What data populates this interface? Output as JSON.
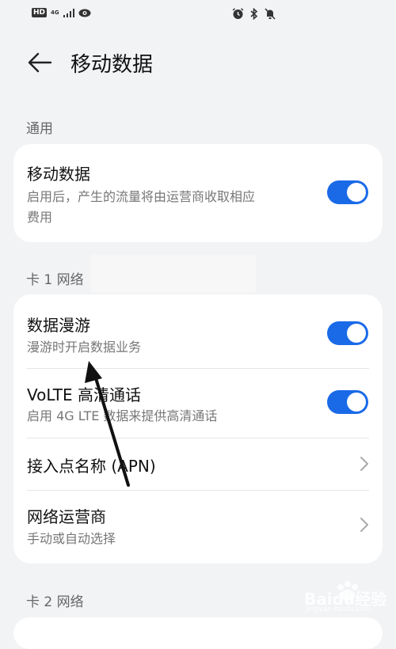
{
  "status_bar": {
    "hd": "HD",
    "network": "4G"
  },
  "header": {
    "title": "移动数据"
  },
  "sections": {
    "general_label": "通用",
    "card1_label": "卡 1 网络",
    "card2_label": "卡 2 网络"
  },
  "mobile_data": {
    "title": "移动数据",
    "subtitle_line1": "启用后，产生的流量将由运营商收取相应",
    "subtitle_line2": "费用",
    "enabled": true
  },
  "roaming": {
    "title": "数据漫游",
    "subtitle": "漫游时开启数据业务",
    "enabled": true
  },
  "volte": {
    "title": "VoLTE 高清通话",
    "subtitle": "启用 4G LTE 数据来提供高清通话",
    "enabled": true
  },
  "apn": {
    "title": "接入点名称 (APN)"
  },
  "operator": {
    "title": "网络运营商",
    "subtitle": "手动或自动选择"
  },
  "watermark": {
    "logo_text": "Baidu经验",
    "url": "jingyan.baidu.com"
  },
  "colors": {
    "accent": "#1a6ae8",
    "background": "#f1f3f5"
  }
}
